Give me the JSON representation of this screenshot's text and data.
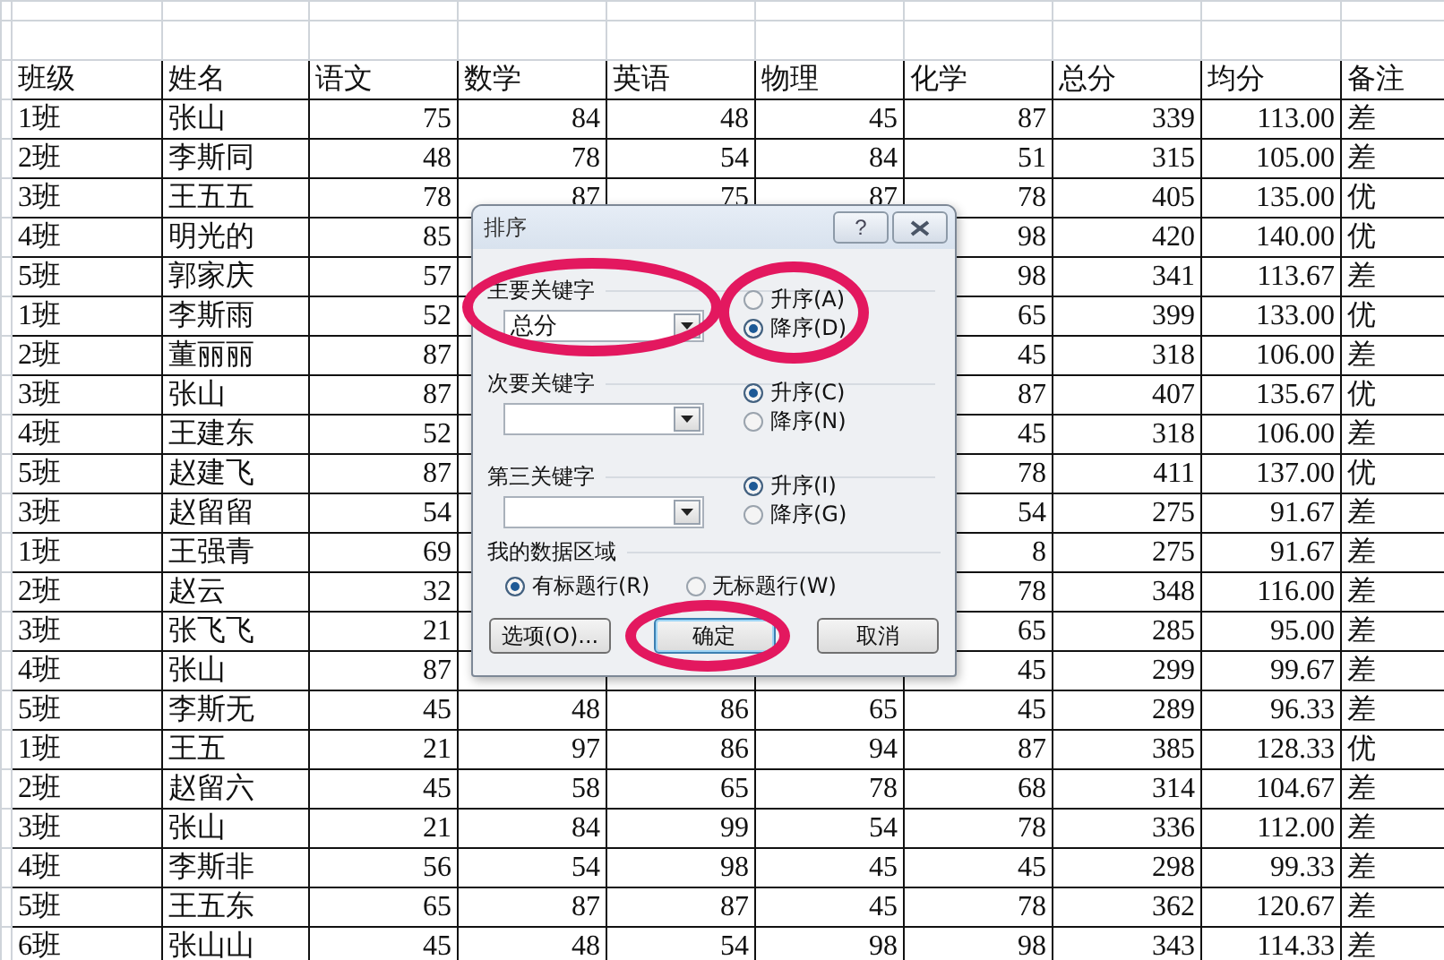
{
  "table": {
    "columns": [
      "班级",
      "姓名",
      "语文",
      "数学",
      "英语",
      "物理",
      "化学",
      "总分",
      "均分",
      "备注"
    ],
    "rows": [
      [
        "1班",
        "张山",
        "75",
        "84",
        "48",
        "45",
        "87",
        "339",
        "113.00",
        "差"
      ],
      [
        "2班",
        "李斯同",
        "48",
        "78",
        "54",
        "84",
        "51",
        "315",
        "105.00",
        "差"
      ],
      [
        "3班",
        "王五五",
        "78",
        "87",
        "75",
        "87",
        "78",
        "405",
        "135.00",
        "优"
      ],
      [
        "4班",
        "明光的",
        "85",
        null,
        null,
        null,
        "98",
        "420",
        "140.00",
        "优"
      ],
      [
        "5班",
        "郭家庆",
        "57",
        null,
        null,
        null,
        "98",
        "341",
        "113.67",
        "差"
      ],
      [
        "1班",
        "李斯雨",
        "52",
        null,
        null,
        null,
        "65",
        "399",
        "133.00",
        "优"
      ],
      [
        "2班",
        "董丽丽",
        "87",
        null,
        null,
        null,
        "45",
        "318",
        "106.00",
        "差"
      ],
      [
        "3班",
        "张山",
        "87",
        null,
        null,
        null,
        "87",
        "407",
        "135.67",
        "优"
      ],
      [
        "4班",
        "王建东",
        "52",
        null,
        null,
        null,
        "45",
        "318",
        "106.00",
        "差"
      ],
      [
        "5班",
        "赵建飞",
        "87",
        null,
        null,
        null,
        "78",
        "411",
        "137.00",
        "优"
      ],
      [
        "3班",
        "赵留留",
        "54",
        null,
        null,
        null,
        "54",
        "275",
        "91.67",
        "差"
      ],
      [
        "1班",
        "王强青",
        "69",
        null,
        null,
        null,
        "8",
        "275",
        "91.67",
        "差"
      ],
      [
        "2班",
        "赵云",
        "32",
        null,
        null,
        null,
        "78",
        "348",
        "116.00",
        "差"
      ],
      [
        "3班",
        "张飞飞",
        "21",
        null,
        null,
        null,
        "65",
        "285",
        "95.00",
        "差"
      ],
      [
        "4班",
        "张山",
        "87",
        null,
        null,
        null,
        "45",
        "299",
        "99.67",
        "差"
      ],
      [
        "5班",
        "李斯无",
        "45",
        "48",
        "86",
        "65",
        "45",
        "289",
        "96.33",
        "差"
      ],
      [
        "1班",
        "王五",
        "21",
        "97",
        "86",
        "94",
        "87",
        "385",
        "128.33",
        "优"
      ],
      [
        "2班",
        "赵留六",
        "45",
        "58",
        "65",
        "78",
        "68",
        "314",
        "104.67",
        "差"
      ],
      [
        "3班",
        "张山",
        "21",
        "84",
        "99",
        "54",
        "78",
        "336",
        "112.00",
        "差"
      ],
      [
        "4班",
        "李斯非",
        "56",
        "54",
        "98",
        "45",
        "45",
        "298",
        "99.33",
        "差"
      ],
      [
        "5班",
        "王五东",
        "65",
        "87",
        "87",
        "45",
        "78",
        "362",
        "120.67",
        "差"
      ],
      [
        "6班",
        "张山山",
        "45",
        "48",
        "54",
        "98",
        "98",
        "343",
        "114.33",
        "差"
      ]
    ]
  },
  "dialog": {
    "title": "排序",
    "help": "?",
    "keys": [
      {
        "label": "主要关键字",
        "value": "总分",
        "highlighted": true,
        "order_highlighted": true,
        "options": [
          {
            "label": "升序(A)",
            "selected": false
          },
          {
            "label": "降序(D)",
            "selected": true
          }
        ]
      },
      {
        "label": "次要关键字",
        "highlighted": false,
        "order_highlighted": false,
        "options": [
          {
            "label": "升序(C)",
            "selected": true
          },
          {
            "label": "降序(N)",
            "selected": false
          }
        ]
      },
      {
        "label": "第三关键字",
        "highlighted": false,
        "order_highlighted": false,
        "options": [
          {
            "label": "升序(I)",
            "selected": true
          },
          {
            "label": "降序(G)",
            "selected": false
          }
        ]
      }
    ],
    "data_range": {
      "label": "我的数据区域",
      "options": [
        {
          "label": "有标题行(R)",
          "selected": true
        },
        {
          "label": "无标题行(W)",
          "selected": false
        }
      ]
    },
    "buttons": [
      {
        "label": "选项(O)...",
        "default": false,
        "highlighted": false
      },
      {
        "label": "确定",
        "default": true,
        "highlighted": true
      },
      {
        "label": "取消",
        "default": false,
        "highlighted": false
      }
    ]
  }
}
